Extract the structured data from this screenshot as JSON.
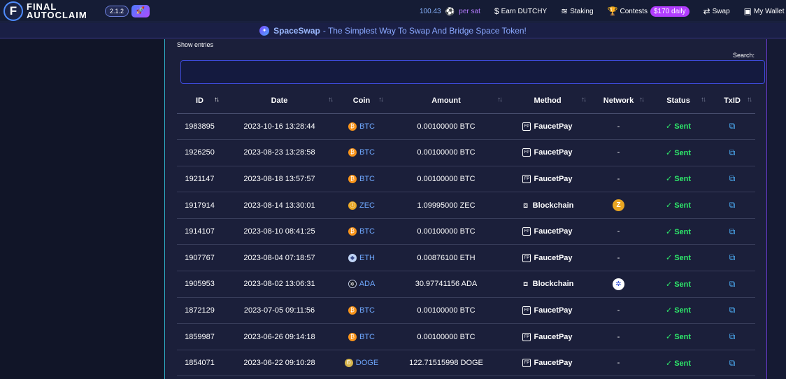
{
  "navbar": {
    "logo_letter": "F",
    "logo_line1": "FINAL",
    "logo_line2": "AUTOCLAIM",
    "version": "2.1.2",
    "rate_value": "100.43",
    "rate_unit": "per sat",
    "items": [
      {
        "label": "Earn DUTCHY",
        "icon": "dollar-icon"
      },
      {
        "label": "Staking",
        "icon": "layers-icon"
      },
      {
        "label": "Contests",
        "icon": "trophy-icon",
        "badge": "$170 daily"
      },
      {
        "label": "Swap",
        "icon": "swap-arrows-icon"
      },
      {
        "label": "My Wallet",
        "icon": "wallet-icon"
      }
    ]
  },
  "banner": {
    "name": "SpaceSwap",
    "tagline": "- The Simplest Way To Swap And Bridge Space Token!"
  },
  "table": {
    "show_entries": "Show entries",
    "search_label": "Search:",
    "search_value": "",
    "columns": [
      "ID",
      "Date",
      "Coin",
      "Amount",
      "Method",
      "Network",
      "Status",
      "TxID"
    ],
    "rows": [
      {
        "id": "1983895",
        "date": "2023-10-16 13:28:44",
        "coin": "BTC",
        "amount": "0.00100000 BTC",
        "method": "FaucetPay",
        "network": "-",
        "status": "Sent"
      },
      {
        "id": "1926250",
        "date": "2023-08-23 13:28:58",
        "coin": "BTC",
        "amount": "0.00100000 BTC",
        "method": "FaucetPay",
        "network": "-",
        "status": "Sent"
      },
      {
        "id": "1921147",
        "date": "2023-08-18 13:57:57",
        "coin": "BTC",
        "amount": "0.00100000 BTC",
        "method": "FaucetPay",
        "network": "-",
        "status": "Sent"
      },
      {
        "id": "1917914",
        "date": "2023-08-14 13:30:01",
        "coin": "ZEC",
        "amount": "1.09995000 ZEC",
        "method": "Blockchain",
        "network": "zec-network-icon",
        "status": "Sent"
      },
      {
        "id": "1914107",
        "date": "2023-08-10 08:41:25",
        "coin": "BTC",
        "amount": "0.00100000 BTC",
        "method": "FaucetPay",
        "network": "-",
        "status": "Sent"
      },
      {
        "id": "1907767",
        "date": "2023-08-04 07:18:57",
        "coin": "ETH",
        "amount": "0.00876100 ETH",
        "method": "FaucetPay",
        "network": "-",
        "status": "Sent"
      },
      {
        "id": "1905953",
        "date": "2023-08-02 13:06:31",
        "coin": "ADA",
        "amount": "30.97741156 ADA",
        "method": "Blockchain",
        "network": "ada-network-icon",
        "status": "Sent"
      },
      {
        "id": "1872129",
        "date": "2023-07-05 09:11:56",
        "coin": "BTC",
        "amount": "0.00100000 BTC",
        "method": "FaucetPay",
        "network": "-",
        "status": "Sent"
      },
      {
        "id": "1859987",
        "date": "2023-06-26 09:14:18",
        "coin": "BTC",
        "amount": "0.00100000 BTC",
        "method": "FaucetPay",
        "network": "-",
        "status": "Sent"
      },
      {
        "id": "1854071",
        "date": "2023-06-22 09:10:28",
        "coin": "DOGE",
        "amount": "122.71515998 DOGE",
        "method": "FaucetPay",
        "network": "-",
        "status": "Sent"
      }
    ]
  },
  "colors": {
    "accent": "#b23dff",
    "status_sent": "#2ee86a",
    "link": "#6fa8ff"
  }
}
